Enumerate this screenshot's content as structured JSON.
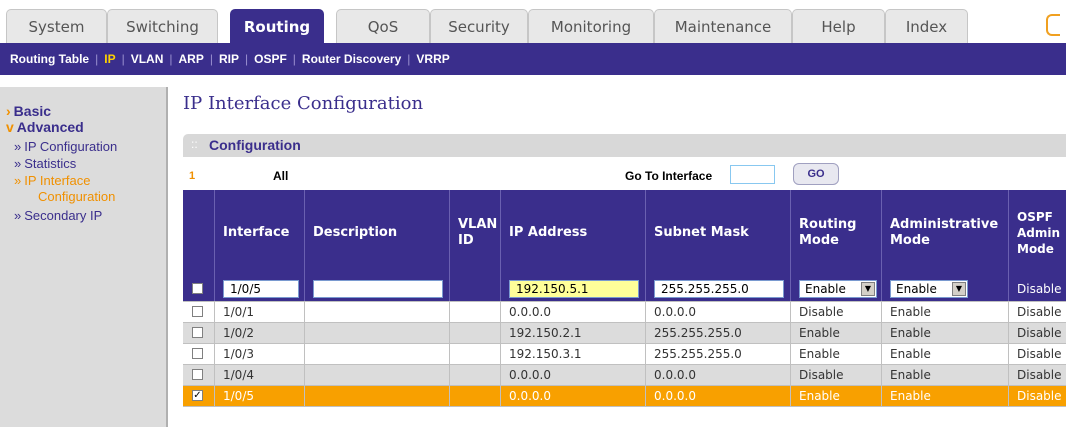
{
  "tabs": [
    "System",
    "Switching",
    "Routing",
    "QoS",
    "Security",
    "Monitoring",
    "Maintenance",
    "Help",
    "Index"
  ],
  "subnav": [
    "Routing Table",
    "IP",
    "VLAN",
    "ARP",
    "RIP",
    "OSPF",
    "Router Discovery",
    "VRRP"
  ],
  "sidebar": {
    "basic": "Basic",
    "advanced": "Advanced",
    "items": [
      "IP Configuration",
      "Statistics",
      "IP Interface",
      "Configuration",
      "Secondary IP"
    ]
  },
  "page_title": "IP Interface Configuration",
  "config_label": "Configuration",
  "go_row": {
    "page": "1",
    "all": "All",
    "goto_label": "Go To Interface",
    "go_button": "GO"
  },
  "columns": [
    "Interface",
    "Description",
    "VLAN ID",
    "IP Address",
    "Subnet Mask",
    "Routing Mode",
    "Administrative Mode",
    "OSPF Admin Mode"
  ],
  "edit_row": {
    "interface": "1/0/5",
    "description": "",
    "ip": "192.150.5.1",
    "mask": "255.255.255.0",
    "routing_mode": "Enable",
    "admin_mode": "Enable",
    "ospf": "Disable"
  },
  "rows": [
    {
      "interface": "1/0/1",
      "ip": "0.0.0.0",
      "mask": "0.0.0.0",
      "routing": "Disable",
      "admin": "Enable",
      "ospf": "Disable",
      "checked": false
    },
    {
      "interface": "1/0/2",
      "ip": "192.150.2.1",
      "mask": "255.255.255.0",
      "routing": "Enable",
      "admin": "Enable",
      "ospf": "Disable",
      "checked": false
    },
    {
      "interface": "1/0/3",
      "ip": "192.150.3.1",
      "mask": "255.255.255.0",
      "routing": "Enable",
      "admin": "Enable",
      "ospf": "Disable",
      "checked": false
    },
    {
      "interface": "1/0/4",
      "ip": "0.0.0.0",
      "mask": "0.0.0.0",
      "routing": "Disable",
      "admin": "Enable",
      "ospf": "Disable",
      "checked": false
    },
    {
      "interface": "1/0/5",
      "ip": "0.0.0.0",
      "mask": "0.0.0.0",
      "routing": "Enable",
      "admin": "Enable",
      "ospf": "Disable",
      "checked": true
    }
  ],
  "colors": {
    "brand": "#3a2e8c",
    "accent": "#f8a000",
    "highlight": "#ffff99"
  }
}
